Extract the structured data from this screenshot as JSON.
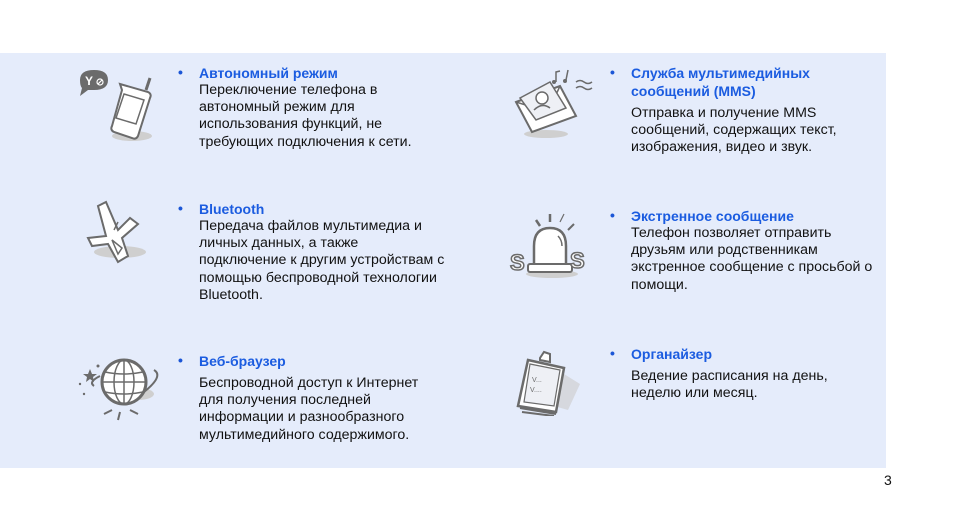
{
  "features": [
    {
      "icon": "phone-offline-icon",
      "title": "Автономный режим",
      "body": "Переключение телефона в автономный режим для использования функций, не требующих подключения к сети."
    },
    {
      "icon": "mms-envelope-icon",
      "title": "Служба мультимедийных сообщений (MMS)",
      "body": "Отправка и получение MMS сообщений, содержащих текст, изображения, видео и звук."
    },
    {
      "icon": "bluetooth-icon",
      "title": "Bluetooth",
      "body": "Передача файлов мультимедиа и личных данных, а также подключение к другим устройствам с помощью беспроводной технологии Bluetooth."
    },
    {
      "icon": "sos-alarm-icon",
      "title": "Экстренное сообщение",
      "body": "Телефон позволяет отправить друзьям или родственникам экстренное сообщение с просьбой о помощи."
    },
    {
      "icon": "globe-icon",
      "title": "Веб-браузер",
      "body": "Беспроводной доступ к Интернет для получения последней информации и разнообразного мультимедийного содержимого."
    },
    {
      "icon": "clipboard-icon",
      "title": "Органайзер",
      "body": "Ведение расписания на день, неделю или месяц."
    }
  ],
  "bullet": "•",
  "page_number": "3",
  "colors": {
    "panel_background": "#e5ecfb",
    "title": "#1b5ce0",
    "icon_stroke": "#6b6b6b"
  }
}
